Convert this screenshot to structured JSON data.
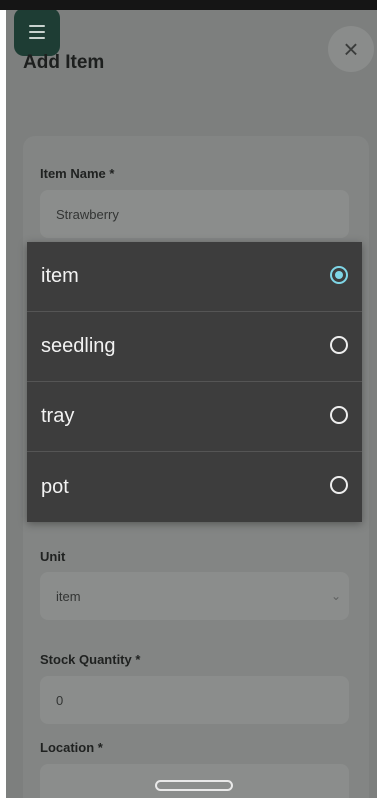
{
  "header": {
    "title": "Add Item",
    "menu_icon": "hamburger-icon",
    "close_label": "×"
  },
  "form": {
    "item_name": {
      "label": "Item Name *",
      "value": "Strawberry"
    },
    "unit": {
      "label": "Unit",
      "value": "item"
    },
    "stock_quantity": {
      "label": "Stock Quantity *",
      "value": "0"
    },
    "location": {
      "label": "Location *"
    }
  },
  "unit_picker": {
    "options": [
      {
        "label": "item",
        "selected": true
      },
      {
        "label": "seedling",
        "selected": false
      },
      {
        "label": "tray",
        "selected": false
      },
      {
        "label": "pot",
        "selected": false
      }
    ],
    "accent": "#7fd6e6"
  }
}
